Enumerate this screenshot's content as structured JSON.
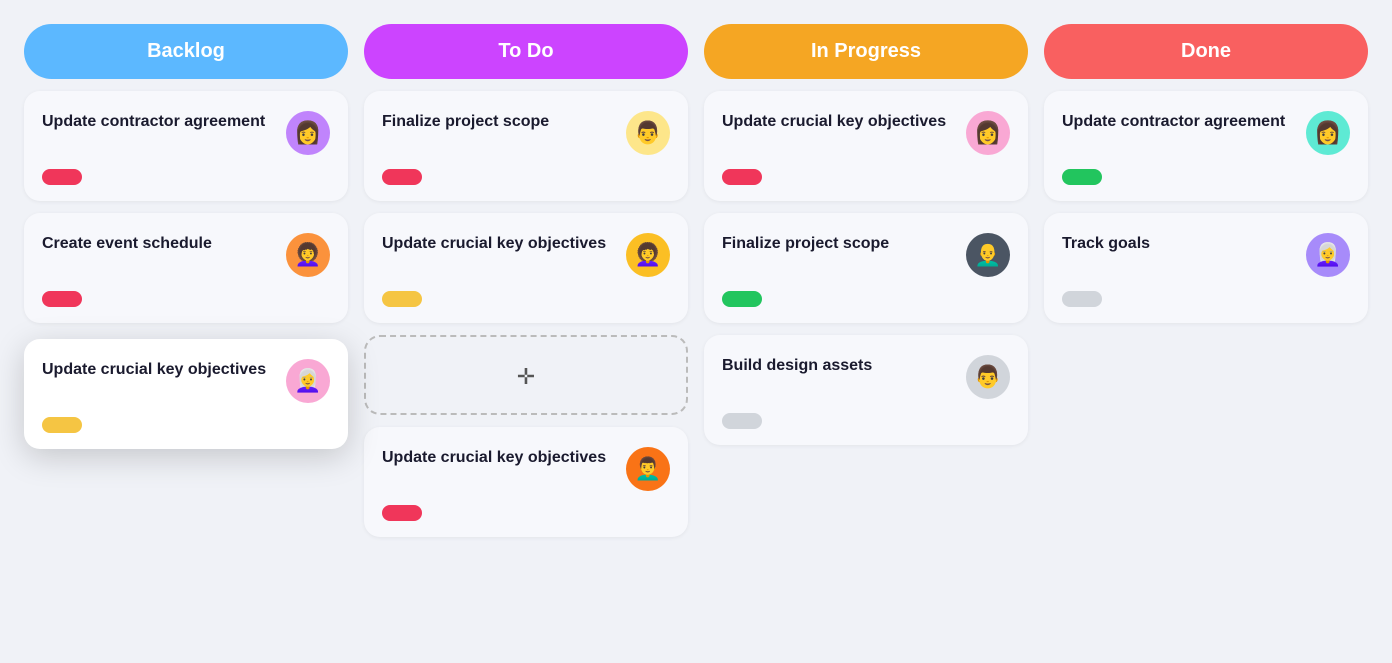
{
  "columns": [
    {
      "id": "backlog",
      "label": "Backlog",
      "colorClass": "col-backlog",
      "cards": [
        {
          "id": "b1",
          "title": "Update contractor agreement",
          "badgeClass": "badge-red",
          "avatarBg": "#c084fc",
          "avatarEmoji": "👩"
        },
        {
          "id": "b2",
          "title": "Create event schedule",
          "badgeClass": "badge-pink",
          "avatarBg": "#fb923c",
          "avatarEmoji": "👩‍🦱"
        }
      ],
      "draggingCard": {
        "title": "Update crucial key objectives",
        "badgeClass": "badge-yellow",
        "avatarBg": "#f9a8d4",
        "avatarEmoji": "👩‍🦳"
      }
    },
    {
      "id": "todo",
      "label": "To Do",
      "colorClass": "col-todo",
      "cards": [
        {
          "id": "t1",
          "title": "Finalize project scope",
          "badgeClass": "badge-red",
          "avatarBg": "#fde68a",
          "avatarEmoji": "👨"
        },
        {
          "id": "t2",
          "title": "Update crucial key objectives",
          "badgeClass": "badge-yellow",
          "avatarBg": "#fbbf24",
          "avatarEmoji": "👩‍🦱"
        },
        {
          "id": "t3",
          "title": "Update crucial key objectives",
          "badgeClass": "badge-red",
          "avatarBg": "#f97316",
          "avatarEmoji": "👨‍🦱"
        }
      ],
      "hasPlaceholder": true
    },
    {
      "id": "inprogress",
      "label": "In Progress",
      "colorClass": "col-inprogress",
      "cards": [
        {
          "id": "ip1",
          "title": "Update crucial key objectives",
          "badgeClass": "badge-red",
          "avatarBg": "#f9a8d4",
          "avatarEmoji": "👩"
        },
        {
          "id": "ip2",
          "title": "Finalize project scope",
          "badgeClass": "badge-green",
          "avatarBg": "#374151",
          "avatarEmoji": "👨‍🦲"
        },
        {
          "id": "ip3",
          "title": "Build design assets",
          "badgeClass": "badge-gray",
          "avatarBg": "#d1d5db",
          "avatarEmoji": "👨"
        }
      ]
    },
    {
      "id": "done",
      "label": "Done",
      "colorClass": "col-done",
      "cards": [
        {
          "id": "d1",
          "title": "Update contractor agreement",
          "badgeClass": "badge-green",
          "avatarBg": "#5eead4",
          "avatarEmoji": "👩"
        },
        {
          "id": "d2",
          "title": "Track goals",
          "badgeClass": "badge-gray",
          "avatarBg": "#a78bfa",
          "avatarEmoji": "👩‍🦳"
        }
      ]
    }
  ]
}
